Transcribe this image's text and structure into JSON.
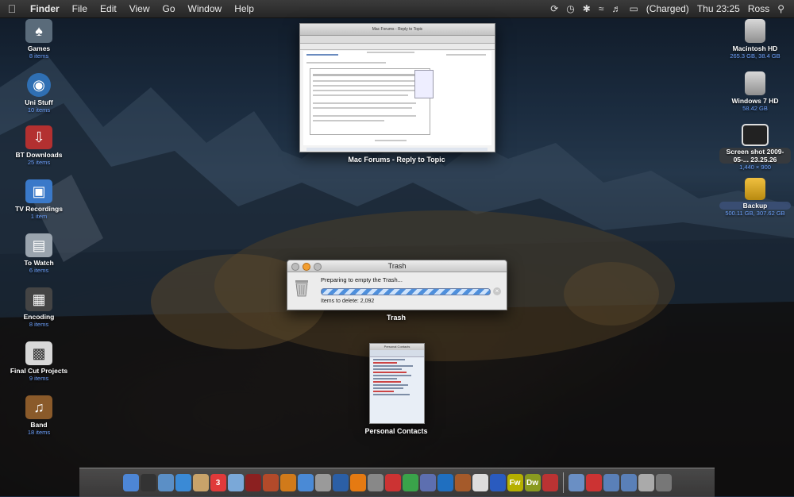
{
  "menubar": {
    "app_name": "Finder",
    "menus": [
      "File",
      "Edit",
      "View",
      "Go",
      "Window",
      "Help"
    ],
    "battery_status": "(Charged)",
    "clock": "Thu 23:25",
    "user": "Ross"
  },
  "desktop_left": [
    {
      "name": "Games",
      "info": "8 items",
      "icon": "games-folder-icon",
      "color": "#5a6b7a"
    },
    {
      "name": "Uni Stuff",
      "info": "10 items",
      "icon": "globe-folder-icon",
      "color": "#2f6fb3"
    },
    {
      "name": "BT Downloads",
      "info": "25 items",
      "icon": "download-folder-icon",
      "color": "#b33030"
    },
    {
      "name": "TV Recordings",
      "info": "1 item",
      "icon": "tv-folder-icon",
      "color": "#3a79c9"
    },
    {
      "name": "To Watch",
      "info": "6 items",
      "icon": "drive-folder-icon",
      "color": "#9aa4ae"
    },
    {
      "name": "Encoding",
      "info": "8 items",
      "icon": "film-folder-icon",
      "color": "#444"
    },
    {
      "name": "Final Cut Projects",
      "info": "9 items",
      "icon": "clapper-folder-icon",
      "color": "#d8d8d8"
    },
    {
      "name": "Band",
      "info": "18 items",
      "icon": "guitar-folder-icon",
      "color": "#8a5a2a"
    }
  ],
  "desktop_right": [
    {
      "name": "Macintosh HD",
      "info": "265.3 GB, 38.4 GB",
      "icon": "hard-drive-icon"
    },
    {
      "name": "Windows 7 HD",
      "info": "58.42 GB",
      "icon": "hard-drive-icon"
    },
    {
      "name": "Screen shot 2009-05-... 23.25.26",
      "info": "1,440 × 900",
      "icon": "screenshot-file-icon"
    },
    {
      "name": "Backup",
      "info": "500.11 GB, 307.62 GB",
      "icon": "backup-drive-icon"
    }
  ],
  "windows": {
    "forum_caption": "Mac Forums - Reply to Topic",
    "forum_title": "Mac Forums - Reply to Topic",
    "trash_caption": "Trash",
    "trash_title": "Trash",
    "trash_message": "Preparing to empty the Trash...",
    "trash_count": "Items to delete: 2,092",
    "contacts_caption": "Personal Contacts",
    "contacts_title": "Personal Contacts"
  },
  "dock_apps": [
    {
      "label": "",
      "icon": "finder-icon",
      "color": "#4d86d6"
    },
    {
      "label": "",
      "icon": "dashboard-icon",
      "color": "#333"
    },
    {
      "label": "",
      "icon": "iphoto-icon",
      "color": "#5b8fc6"
    },
    {
      "label": "",
      "icon": "safari-icon",
      "color": "#3a8ad6"
    },
    {
      "label": "",
      "icon": "preview-icon",
      "color": "#c9a36a"
    },
    {
      "label": "3",
      "icon": "ical-icon",
      "color": "#e03a3a"
    },
    {
      "label": "",
      "icon": "iphoto-icon-2",
      "color": "#7aa8d8"
    },
    {
      "label": "",
      "icon": "photo-booth-icon",
      "color": "#8b2020"
    },
    {
      "label": "",
      "icon": "aperture-icon",
      "color": "#b34a2a"
    },
    {
      "label": "",
      "icon": "front-row-icon",
      "color": "#d17a1a"
    },
    {
      "label": "",
      "icon": "itunes-icon",
      "color": "#4a8ad6"
    },
    {
      "label": "",
      "icon": "trash-app-icon",
      "color": "#9a9a9a"
    },
    {
      "label": "",
      "icon": "quicktime-icon",
      "color": "#2b5fa6"
    },
    {
      "label": "",
      "icon": "vlc-icon",
      "color": "#e57a12"
    },
    {
      "label": "",
      "icon": "utility-icon",
      "color": "#888"
    },
    {
      "label": "",
      "icon": "quick-app-icon",
      "color": "#c33"
    },
    {
      "label": "",
      "icon": "messenger-icon",
      "color": "#3aa34a"
    },
    {
      "label": "",
      "icon": "transmit-icon",
      "color": "#5d6fb0"
    },
    {
      "label": "",
      "icon": "terminal-icon",
      "color": "#1f6fc0"
    },
    {
      "label": "",
      "icon": "game-app-icon",
      "color": "#a55a2a"
    },
    {
      "label": "",
      "icon": "textedit-icon",
      "color": "#ddd"
    },
    {
      "label": "",
      "icon": "word-icon",
      "color": "#2a5bbf"
    },
    {
      "label": "Fw",
      "icon": "fireworks-icon",
      "color": "#b6b000"
    },
    {
      "label": "Dw",
      "icon": "dreamweaver-icon",
      "color": "#8a9a20"
    },
    {
      "label": "",
      "icon": "mail-icon",
      "color": "#b33"
    }
  ],
  "dock_stacks": [
    {
      "label": "",
      "icon": "applications-stack-icon",
      "color": "#6a8fc4"
    },
    {
      "label": "",
      "icon": "downloads-stack-icon",
      "color": "#c33"
    },
    {
      "label": "",
      "icon": "documents-stack-icon",
      "color": "#5a80b8"
    },
    {
      "label": "",
      "icon": "folder-stack-icon",
      "color": "#5a80b8"
    },
    {
      "label": "",
      "icon": "screenshot-stack-icon",
      "color": "#aaa"
    },
    {
      "label": "",
      "icon": "trash-dock-icon",
      "color": "#777"
    }
  ]
}
